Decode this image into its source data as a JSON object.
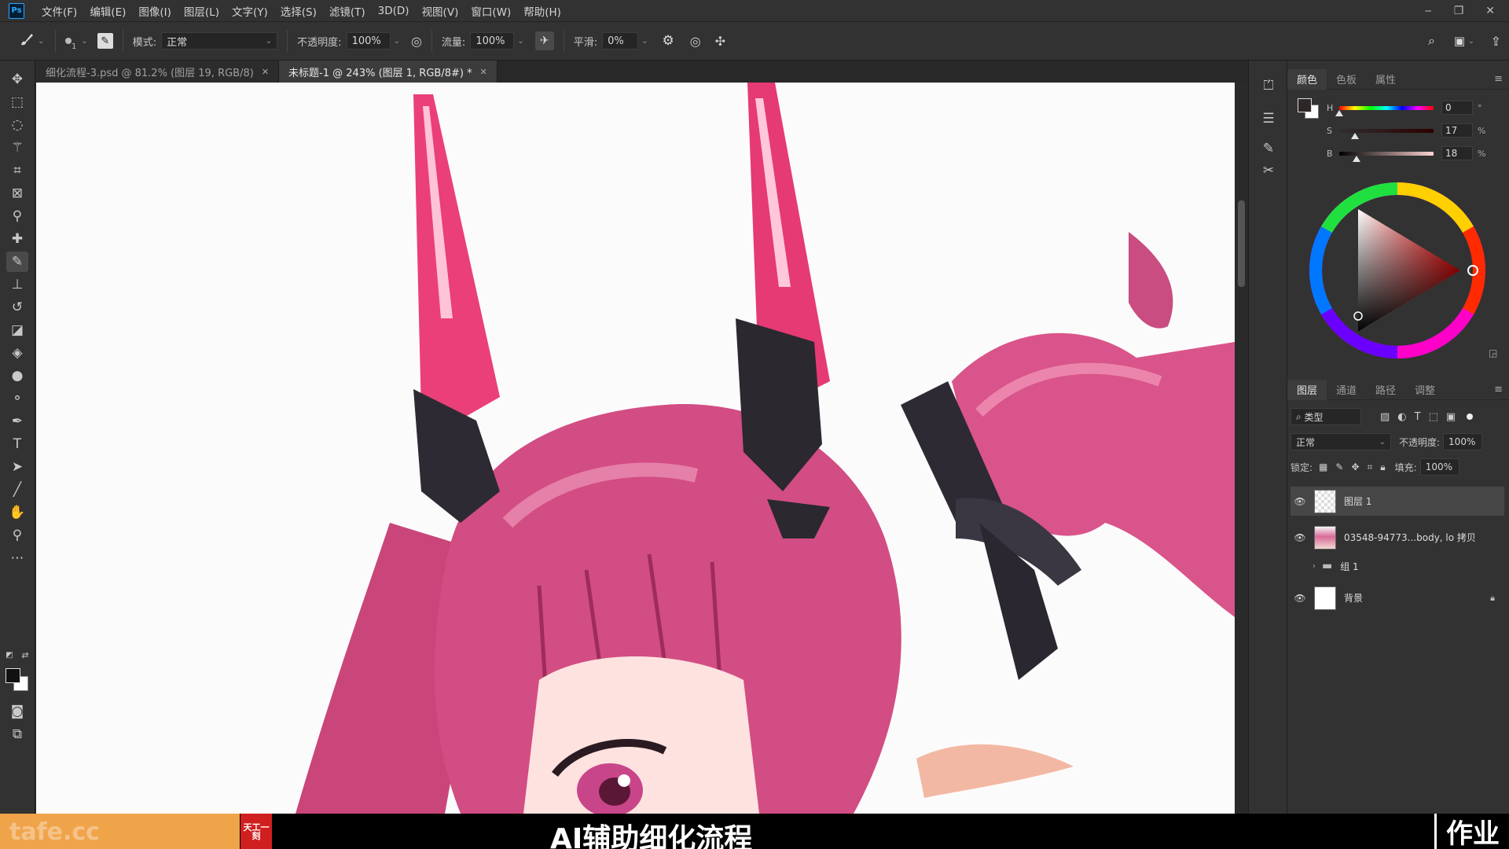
{
  "app": {
    "logo": "Ps"
  },
  "menu": [
    "文件(F)",
    "编辑(E)",
    "图像(I)",
    "图层(L)",
    "文字(Y)",
    "选择(S)",
    "滤镜(T)",
    "3D(D)",
    "视图(V)",
    "窗口(W)",
    "帮助(H)"
  ],
  "options": {
    "brush_size": "1",
    "mode_label": "模式:",
    "mode_value": "正常",
    "opacity_label": "不透明度:",
    "opacity_value": "100%",
    "flow_label": "流量:",
    "flow_value": "100%",
    "smoothing_label": "平滑:",
    "smoothing_value": "0%"
  },
  "tabs": [
    {
      "label": "细化流程-3.psd @ 81.2% (图层 19, RGB/8)",
      "active": false
    },
    {
      "label": "未标题-1 @ 243% (图层 1, RGB/8#) *",
      "active": true
    }
  ],
  "color_panel": {
    "tabs": [
      "颜色",
      "色板",
      "属性"
    ],
    "h": {
      "label": "H",
      "value": "0",
      "unit": "°",
      "fraction": 0.0
    },
    "s": {
      "label": "S",
      "value": "17",
      "unit": "%",
      "fraction": 0.17
    },
    "b": {
      "label": "B",
      "value": "18",
      "unit": "%",
      "fraction": 0.18
    },
    "foreground": "#2e2727",
    "background": "#ffffff"
  },
  "layers_panel": {
    "tabs": [
      "图层",
      "通道",
      "路径",
      "调整"
    ],
    "filter_label": "类型",
    "blend_mode": "正常",
    "opacity_label": "不透明度:",
    "opacity_value": "100%",
    "lock_label": "锁定:",
    "fill_label": "填充:",
    "fill_value": "100%",
    "layers": [
      {
        "name": "图层 1",
        "visible": true,
        "selected": true,
        "kind": "transparent"
      },
      {
        "name": "03548-94773...body, lo 拷贝",
        "visible": true,
        "selected": false,
        "kind": "image"
      },
      {
        "name": "组 1",
        "visible": false,
        "selected": false,
        "kind": "group"
      },
      {
        "name": "背景",
        "visible": true,
        "selected": false,
        "kind": "background",
        "locked": true
      }
    ]
  },
  "overlay": {
    "watermark": "tafe.cc",
    "logo_text": "天工一刻",
    "title": "AI辅助细化流程",
    "right_text": "作业"
  }
}
